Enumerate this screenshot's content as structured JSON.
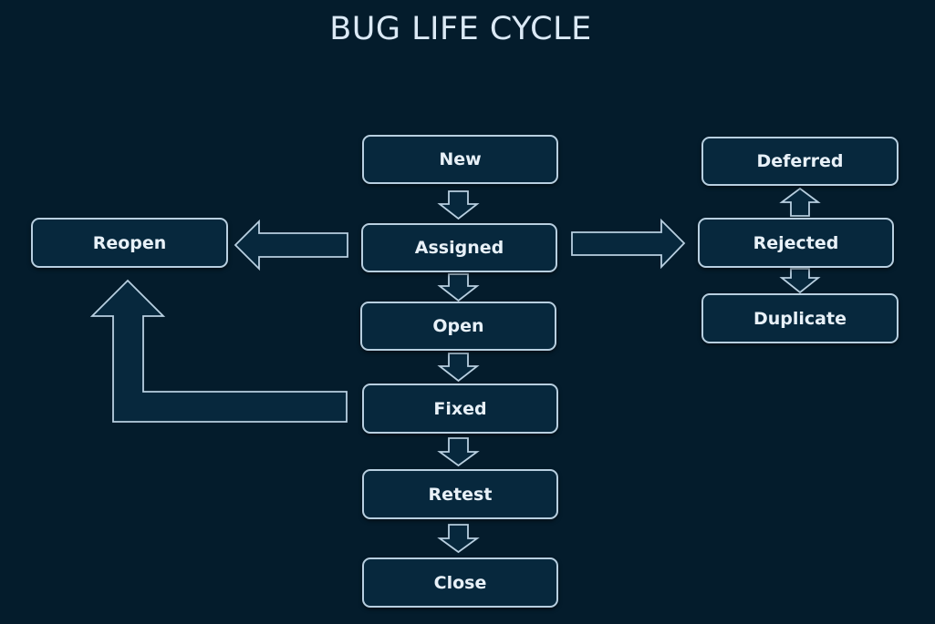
{
  "title": "BUG LIFE CYCLE",
  "colors": {
    "background": "#041c2c",
    "node_fill": "#07283d",
    "node_border": "#b8cfe0",
    "text": "#e8f1f8"
  },
  "nodes": {
    "new": "New",
    "assigned": "Assigned",
    "open": "Open",
    "fixed": "Fixed",
    "retest": "Retest",
    "close": "Close",
    "reopen": "Reopen",
    "deferred": "Deferred",
    "rejected": "Rejected",
    "duplicate": "Duplicate"
  },
  "edges": [
    {
      "from": "New",
      "to": "Assigned"
    },
    {
      "from": "Assigned",
      "to": "Open"
    },
    {
      "from": "Open",
      "to": "Fixed"
    },
    {
      "from": "Fixed",
      "to": "Retest"
    },
    {
      "from": "Retest",
      "to": "Close"
    },
    {
      "from": "Assigned",
      "to": "Reopen"
    },
    {
      "from": "Fixed",
      "to": "Reopen"
    },
    {
      "from": "Assigned",
      "to": "Rejected"
    },
    {
      "from": "Rejected",
      "to": "Deferred"
    },
    {
      "from": "Rejected",
      "to": "Duplicate"
    }
  ]
}
